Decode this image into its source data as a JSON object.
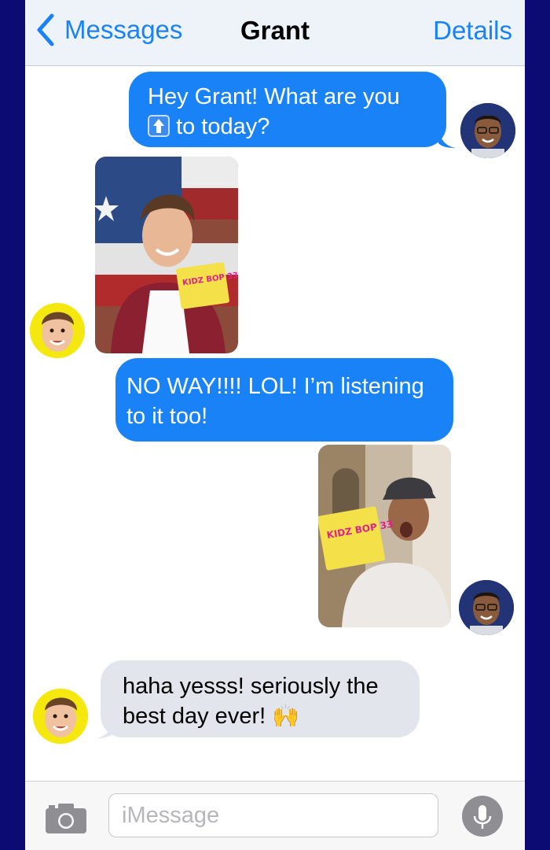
{
  "header": {
    "back_label": "Messages",
    "title": "Grant",
    "details_label": "Details"
  },
  "messages": [
    {
      "direction": "outgoing",
      "line1": "Hey Grant! What are you",
      "line2_text": "to today?",
      "inline_icon": "up-arrow-emoji"
    },
    {
      "direction": "incoming",
      "type": "photo",
      "content": "boy holding KIDZ BOP 33 album in front of a Texas flag",
      "album_label": "KIDZ BOP 33"
    },
    {
      "direction": "outgoing",
      "line1": "NO WAY!!!! LOL! I’m listening",
      "line2": "to it too!"
    },
    {
      "direction": "outgoing",
      "type": "photo",
      "content": "boy in cap holding KIDZ BOP 33 album",
      "album_label": "KIDZ BOP 33"
    },
    {
      "direction": "incoming",
      "line1": "haha yesss! seriously the",
      "line2_text": "best day ever!",
      "emoji": "🙌"
    }
  ],
  "composer": {
    "placeholder": "iMessage",
    "camera_icon": "camera-icon",
    "mic_icon": "microphone-icon"
  },
  "colors": {
    "outgoing_bubble": "#1a82f7",
    "incoming_bubble": "#e3e5ec",
    "frame": "#0b0b73",
    "accent": "#1a82f7"
  }
}
